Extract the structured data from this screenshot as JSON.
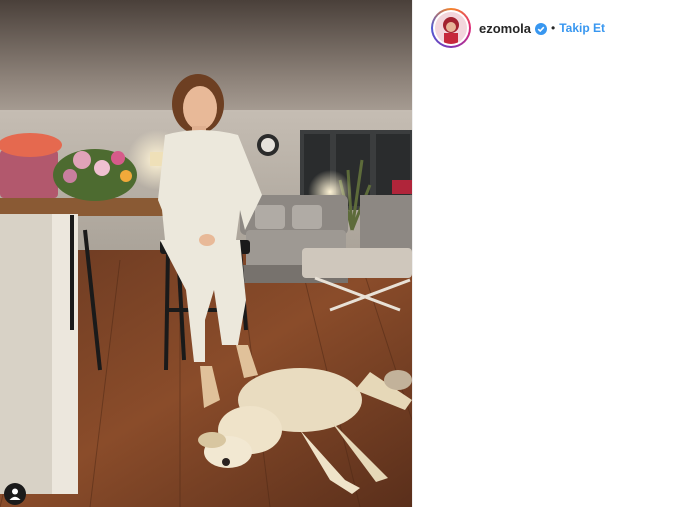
{
  "post": {
    "username": "ezomola",
    "verified": true,
    "separator": "•",
    "follow_label": "Takip Et",
    "follow_color": "#3897f0"
  },
  "icons": {
    "verified": "verified-badge-icon",
    "tag": "user-tag-icon"
  }
}
